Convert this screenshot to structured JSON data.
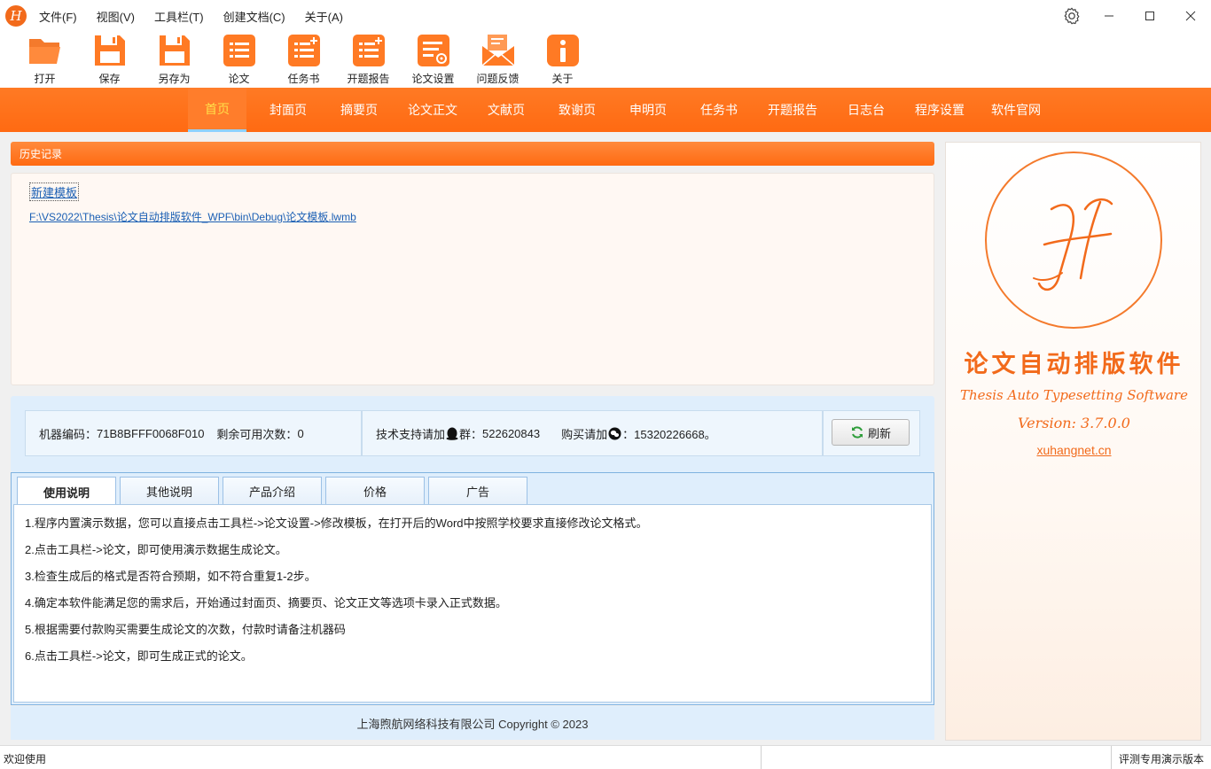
{
  "app": {
    "logo_letter": "H"
  },
  "menu": [
    "文件(F)",
    "视图(V)",
    "工具栏(T)",
    "创建文档(C)",
    "关于(A)"
  ],
  "toolbar": [
    {
      "label": "打开",
      "icon": "folder-open-icon"
    },
    {
      "label": "保存",
      "icon": "floppy-disk-icon"
    },
    {
      "label": "另存为",
      "icon": "floppy-disk-icon"
    },
    {
      "label": "论文",
      "icon": "document-list-icon"
    },
    {
      "label": "任务书",
      "icon": "document-list-icon"
    },
    {
      "label": "开题报告",
      "icon": "document-list-icon"
    },
    {
      "label": "论文设置",
      "icon": "document-settings-icon"
    },
    {
      "label": "问题反馈",
      "icon": "envelope-icon"
    },
    {
      "label": "关于",
      "icon": "info-icon"
    }
  ],
  "nav": [
    "首页",
    "封面页",
    "摘要页",
    "论文正文",
    "文献页",
    "致谢页",
    "申明页",
    "任务书",
    "开题报告",
    "日志台",
    "程序设置",
    "软件官网"
  ],
  "nav_active": "首页",
  "history": {
    "title": "历史记录",
    "new_template": "新建模板",
    "path": "F:\\VS2022\\Thesis\\论文自动排版软件_WPF\\bin\\Debug\\论文模板.lwmb"
  },
  "info": {
    "machine_label": "机器编码：",
    "machine_code": "71B8BFFF0068F010",
    "remaining_label": "剩余可用次数：",
    "remaining": "0",
    "support_label": "技术支持请加",
    "support_suffix": "群：",
    "support_group": "522620843",
    "buy_label": "购买请加",
    "buy_suffix": "：",
    "buy_id": "15320226668。",
    "refresh": "刷新"
  },
  "tabs": [
    "使用说明",
    "其他说明",
    "产品介绍",
    "价格",
    "广告"
  ],
  "tab_active": "使用说明",
  "instructions": [
    "1.程序内置演示数据，您可以直接点击工具栏->论文设置->修改模板，在打开后的Word中按照学校要求直接修改论文格式。",
    "2.点击工具栏->论文，即可使用演示数据生成论文。",
    "3.检查生成后的格式是否符合预期，如不符合重复1-2步。",
    "4.确定本软件能满足您的需求后，开始通过封面页、摘要页、论文正文等选项卡录入正式数据。",
    "5.根据需要付款购买需要生成论文的次数，付款时请备注机器码",
    "6.点击工具栏->论文，即可生成正式的论文。"
  ],
  "copyright": "上海煦航网络科技有限公司 Copyright © 2023",
  "brand": {
    "letter": "H",
    "title": "论文自动排版软件",
    "subtitle": "Thesis Auto Typesetting Software",
    "version": "Version: 3.7.0.0",
    "link": "xuhangnet.cn"
  },
  "status": {
    "left": "欢迎使用",
    "right": "评测专用演示版本"
  },
  "colors": {
    "accent": "#ff6a12",
    "link": "#1a5fb4",
    "panel": "#dfeefc"
  }
}
